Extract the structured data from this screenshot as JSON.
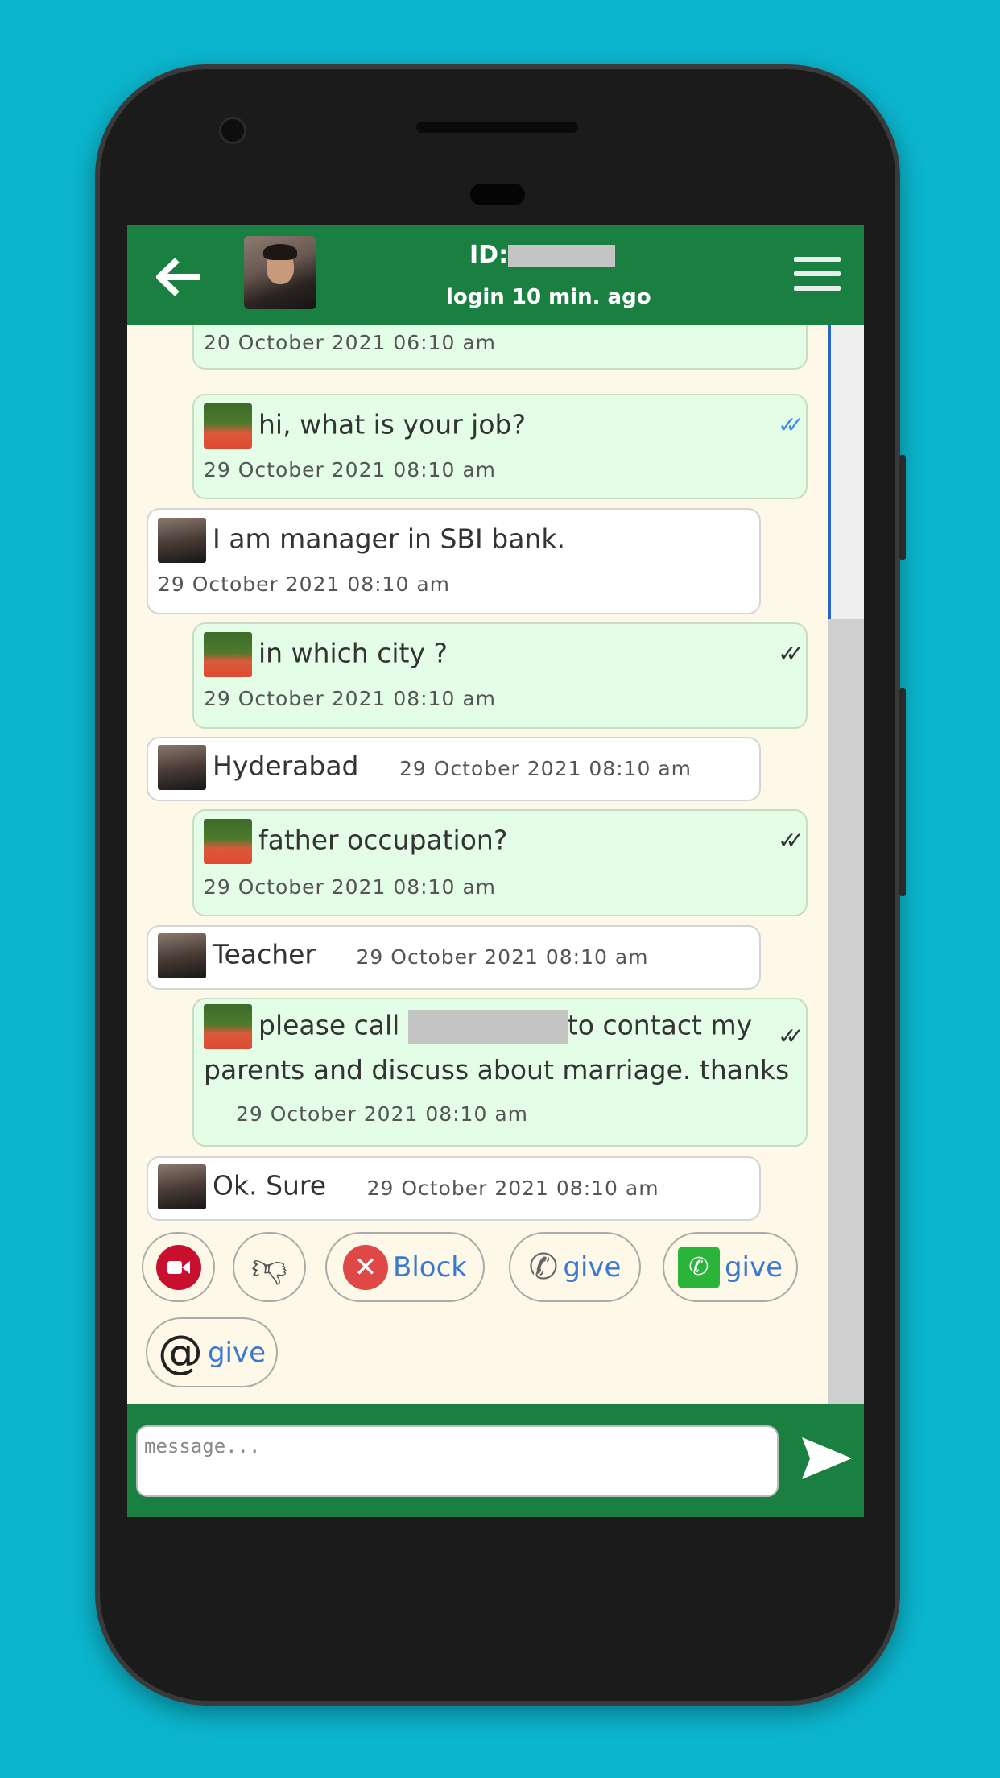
{
  "header": {
    "back_icon": "arrow-left-icon",
    "id_label": "ID:",
    "status": "login 10 min. ago",
    "menu_icon": "hamburger-icon"
  },
  "messages": [
    {
      "side": "sent",
      "text": "",
      "time": "20 October 2021 06:10 am"
    },
    {
      "side": "sent",
      "text": "hi, what is your job?",
      "time": "29 October 2021 08:10 am",
      "read": true
    },
    {
      "side": "received",
      "text": "I am manager in SBI bank.",
      "time": "29 October 2021 08:10 am"
    },
    {
      "side": "sent",
      "text": "in which city ?",
      "time": "29 October 2021 08:10 am",
      "read": false
    },
    {
      "side": "received",
      "text": "Hyderabad",
      "time": "29 October 2021 08:10 am"
    },
    {
      "side": "sent",
      "text": "father occupation?",
      "time": "29 October 2021 08:10 am",
      "read": false
    },
    {
      "side": "received",
      "text": "Teacher",
      "time": "29 October 2021 08:10 am"
    },
    {
      "side": "sent",
      "text_before": "please call",
      "text_after": "to contact my parents and discuss about marriage. thanks",
      "time": "29 October 2021 08:10 am",
      "read": false
    },
    {
      "side": "received",
      "text": "Ok. Sure",
      "time": "29 October 2021 08:10 am"
    }
  ],
  "actions": {
    "video": "video-call-icon",
    "dislike": "thumbs-down-icon",
    "block": "Block",
    "phone_give": "give",
    "whatsapp_give": "give",
    "email_give": "give"
  },
  "composer": {
    "placeholder": "message...",
    "send_icon": "send-icon"
  },
  "colors": {
    "header": "#1a8041",
    "sent_bubble": "#e4fde6",
    "chat_bg": "#fdf8e7",
    "link": "#3b78d0",
    "background": "#0bb5cd"
  }
}
